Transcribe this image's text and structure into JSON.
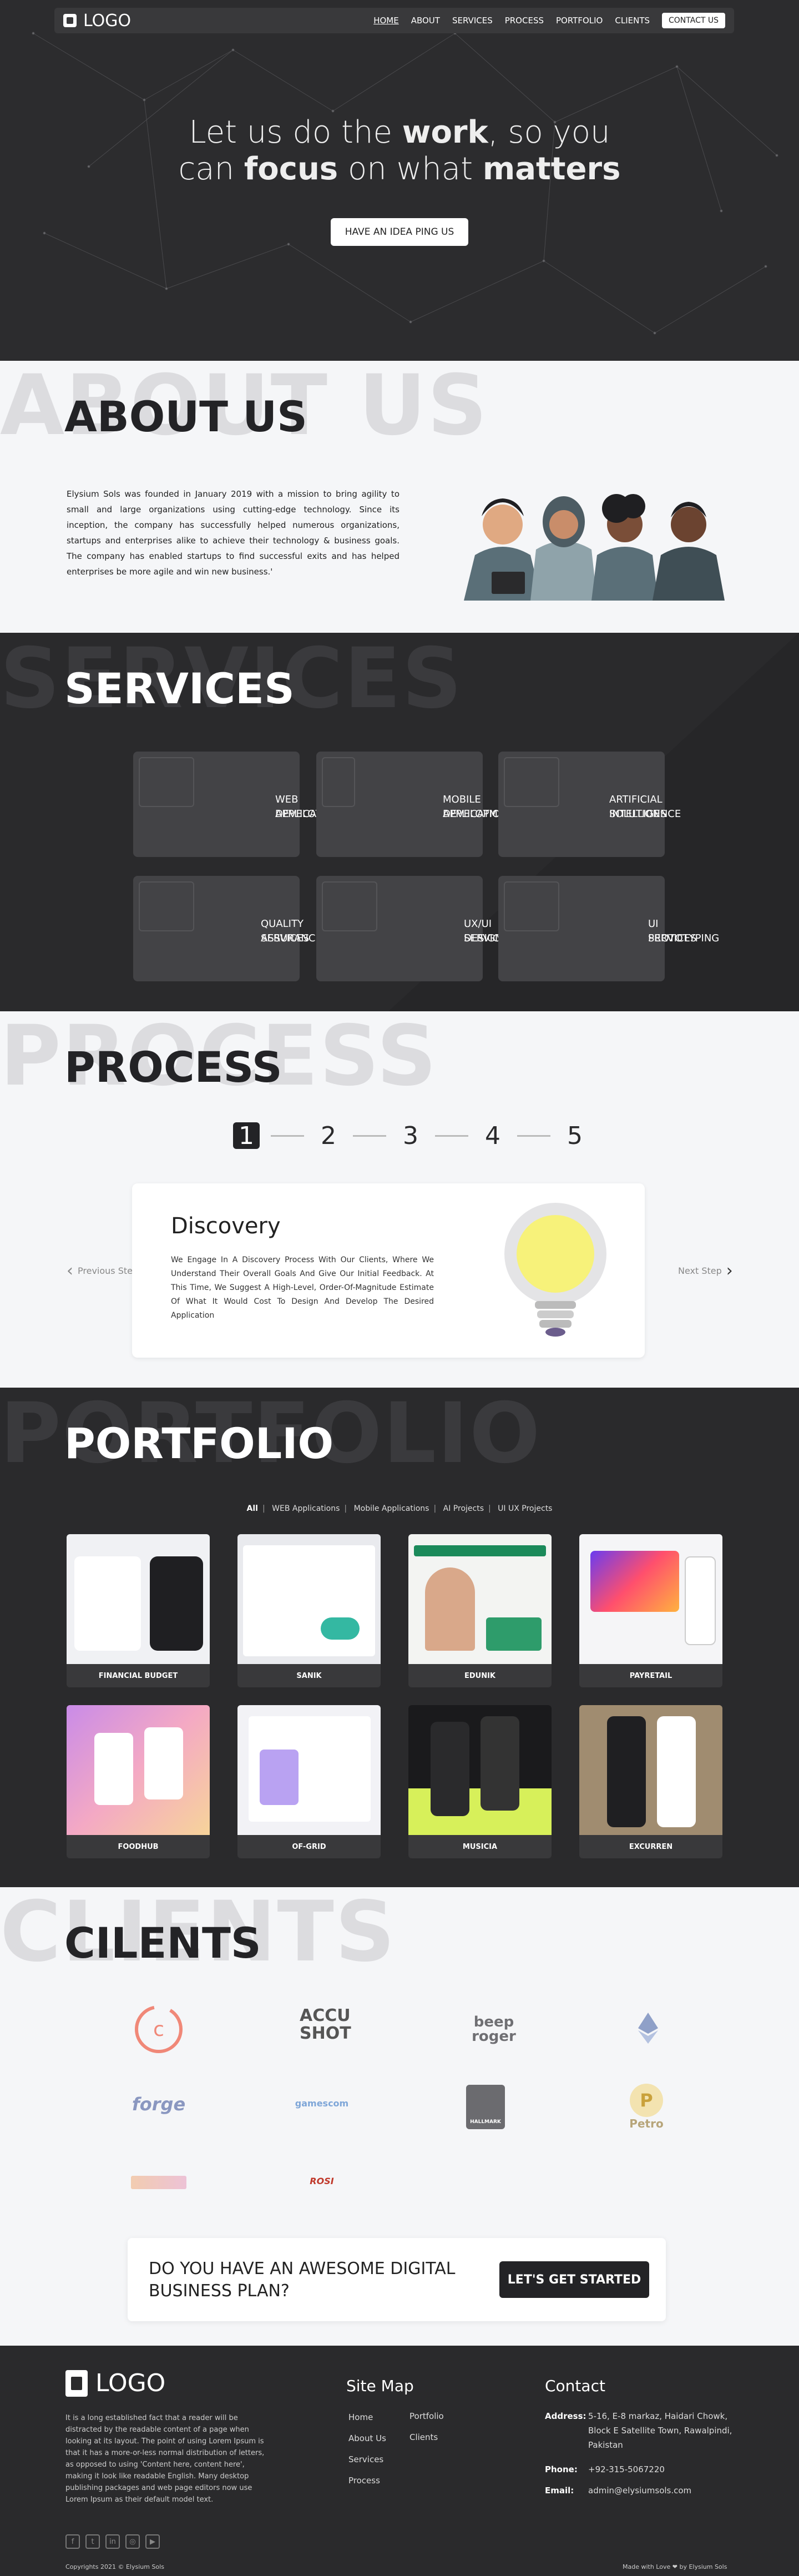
{
  "header": {
    "logo_text": "LOGO",
    "menu": [
      "HOME",
      "ABOUT",
      "SERVICES",
      "PROCESS",
      "PORTFOLIO",
      "CLIENTS"
    ],
    "contact_label": "CONTACT US"
  },
  "hero": {
    "line1_a": "Let us do the ",
    "line1_b": "work",
    "line1_c": ", so you",
    "line2_a": "can ",
    "line2_b": "focus",
    "line2_c": " on what ",
    "line2_d": "matters",
    "cta": "HAVE AN IDEA PING US"
  },
  "about": {
    "ghost": "ABOUT US",
    "title": "ABOUT US",
    "text": "Elysium Sols was founded in January 2019 with a mission to bring agility to small and large organizations using cutting-edge technology. Since its inception, the company has successfully helped numerous organizations, startups and enterprises alike to achieve their technology & business goals. The company has enabled startups to find successful exits and has helped enterprises be more agile and win new business.'"
  },
  "services": {
    "ghost": "SERVICES",
    "title": "SERVICES",
    "items": [
      {
        "line1": "WEB APPLICATION",
        "line2": "DEVELOPMENT"
      },
      {
        "line1": "MOBILE APPLICATION",
        "line2": "DEVELOPMENT"
      },
      {
        "line1": "ARTIFICIAL INTELLIGENCE",
        "line2": "SOLUTIONS"
      },
      {
        "line1": "QUALITY ASSURANCE",
        "line2": "SERVICES"
      },
      {
        "line1": "UX/UI DESIGNING",
        "line2": "SERVICES"
      },
      {
        "line1": "UI PROTOTYPING",
        "line2": "SERVICES"
      }
    ]
  },
  "process": {
    "ghost": "PROCESS",
    "title": "PROCESS",
    "steps": [
      "1",
      "2",
      "3",
      "4",
      "5"
    ],
    "active_step": 1,
    "card_title": "Discovery",
    "card_text": "We Engage In A Discovery Process With Our Clients, Where We Understand Their Overall Goals And Give Our Initial Feedback. At This Time, We Suggest A High-Level, Order-Of-Magnitude Estimate Of What It Would Cost To Design And Develop The Desired Application",
    "prev": "Previous Step",
    "next": "Next Step"
  },
  "portfolio": {
    "ghost": "PORTFOLIO",
    "title": "PORTFOLIO",
    "filters": [
      "All",
      "WEB Applications",
      "Mobile Applications",
      "AI Projects",
      "UI UX Projects"
    ],
    "items": [
      "FINANCIAL BUDGET",
      "SANIK",
      "EDUNIK",
      "PAYRETAIL",
      "FOODHUB",
      "OF-GRID",
      "MUSICIA",
      "EXCURREN"
    ]
  },
  "clients": {
    "ghost": "CLIENTS",
    "title": "CILENTS",
    "logos": [
      "",
      "ACCU SHOT",
      "beep roger",
      "",
      "forge",
      "gamescom",
      "HALLMARK",
      "Petro",
      "",
      "ROSI"
    ]
  },
  "cta": {
    "question": "DO YOU HAVE AN AWESOME DIGITAL BUSINESS PLAN?",
    "button": "LET'S GET STARTED"
  },
  "footer": {
    "logo_text": "LOGO",
    "description": "It is a long established fact that a reader will be distracted by the readable content of a page when looking at its layout. The point of using Lorem Ipsum is that it has a more-or-less normal distribution of letters, as opposed to using 'Content here, content here', making it look like readable English. Many desktop publishing packages and web page editors now use Lorem Ipsum as their default model text.",
    "sitemap_title": "Site Map",
    "sitemap_col1": [
      "Home",
      "About Us",
      "Services",
      "Process"
    ],
    "sitemap_col2": [
      "Portfolio",
      "Clients"
    ],
    "contact_title": "Contact",
    "address_label": "Address:",
    "address": "5-16, E-8 markaz, Haidari Chowk, Block E Satellite Town, Rawalpindi, Pakistan",
    "phone_label": "Phone:",
    "phone": "+92-315-5067220",
    "email_label": "Email:",
    "email": "admin@elysiumsols.com",
    "copyright": "Copyrights 2021 © Elysium Sols",
    "made_with": "Made with Love ❤ by Elysium Sols"
  }
}
